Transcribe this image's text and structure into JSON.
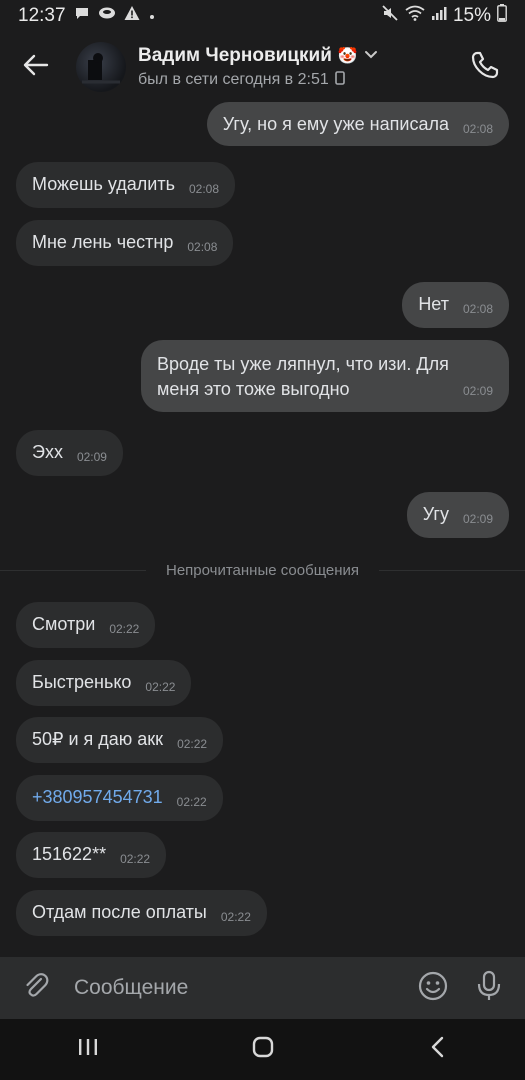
{
  "status_bar": {
    "time": "12:37",
    "battery": "15%"
  },
  "header": {
    "contact_name": "Вадим Черновицкий",
    "contact_status": "был в сети сегодня в 2:51",
    "emoji": "🤡"
  },
  "messages": [
    {
      "text": "Угу, но я ему уже написала",
      "time": "02:08",
      "dir": "out"
    },
    {
      "text": "Можешь удалить",
      "time": "02:08",
      "dir": "in"
    },
    {
      "text": "Мне лень честнр",
      "time": "02:08",
      "dir": "in"
    },
    {
      "text": "Нет",
      "time": "02:08",
      "dir": "out"
    },
    {
      "text": "Вроде ты уже ляпнул, что изи. Для меня это тоже выгодно",
      "time": "02:09",
      "dir": "out"
    },
    {
      "text": "Эхх",
      "time": "02:09",
      "dir": "in"
    },
    {
      "text": "Угу",
      "time": "02:09",
      "dir": "out"
    },
    {
      "text": "Смотри",
      "time": "02:22",
      "dir": "in"
    },
    {
      "text": "Быстренько",
      "time": "02:22",
      "dir": "in"
    },
    {
      "text": "50₽ и я даю акк",
      "time": "02:22",
      "dir": "in"
    },
    {
      "text": "+380957454731",
      "time": "02:22",
      "dir": "in"
    },
    {
      "text": "151622**",
      "time": "02:22",
      "dir": "in"
    },
    {
      "text": "Отдам после оплаты",
      "time": "02:22",
      "dir": "in"
    }
  ],
  "unread_divider": "Непрочитанные сообщения",
  "composer": {
    "placeholder": "Сообщение"
  }
}
